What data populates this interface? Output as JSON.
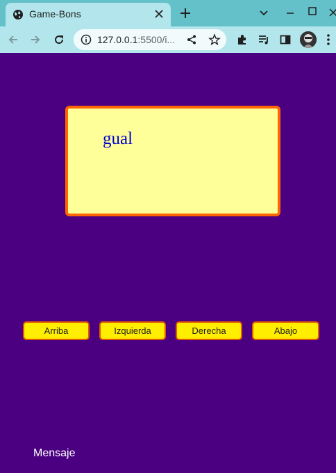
{
  "browser": {
    "tab_title": "Game-Bons",
    "url_host": "127.0.0.1",
    "url_rest": ":5500/i...",
    "icons": [
      "globe-icon",
      "close-icon",
      "plus-icon",
      "chevron-down-icon",
      "minimize-icon",
      "maximize-icon",
      "back-icon",
      "forward-icon",
      "reload-icon",
      "info-icon",
      "share-icon",
      "star-icon",
      "extensions-icon",
      "media-icon",
      "sidepanel-icon",
      "avatar",
      "menu-icon"
    ]
  },
  "game": {
    "word": "gual",
    "buttons": {
      "up": "Arriba",
      "left": "Izquierda",
      "right": "Derecha",
      "down": "Abajo"
    },
    "message": "Mensaje"
  },
  "colors": {
    "page_bg": "#4b0082",
    "card_bg": "#ffff99",
    "card_border": "#ff6600",
    "word_color": "#0000cc",
    "button_bg": "#ffee00",
    "button_border": "#e05a00"
  }
}
